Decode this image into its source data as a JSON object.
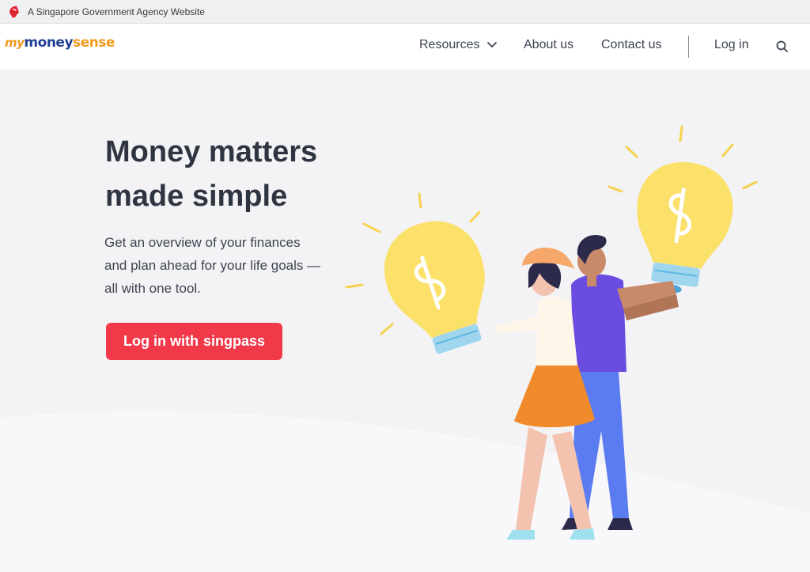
{
  "gov_bar": {
    "text": "A Singapore Government Agency Website",
    "icon": "lion-head-icon"
  },
  "nav": {
    "logo": {
      "my": "my",
      "money": "money",
      "sense": "sense"
    },
    "items": [
      {
        "label": "Resources",
        "icon": "chevron-down-icon"
      },
      {
        "label": "About us"
      },
      {
        "label": "Contact us"
      },
      {
        "label": "Log in"
      }
    ],
    "search_icon": "search-icon"
  },
  "hero": {
    "headline": [
      "Money matters",
      "made simple"
    ],
    "subtext": [
      "Get an overview of your finances",
      "and plan ahead for your life goals —",
      "all with one tool."
    ],
    "cta": {
      "prefix": "Log in with",
      "brand": "singpass"
    }
  },
  "colors": {
    "accent": "#f2394a",
    "brand_blue": "#1f3f95",
    "brand_orange": "#f29a1f",
    "bulb": "#fbe06a"
  }
}
